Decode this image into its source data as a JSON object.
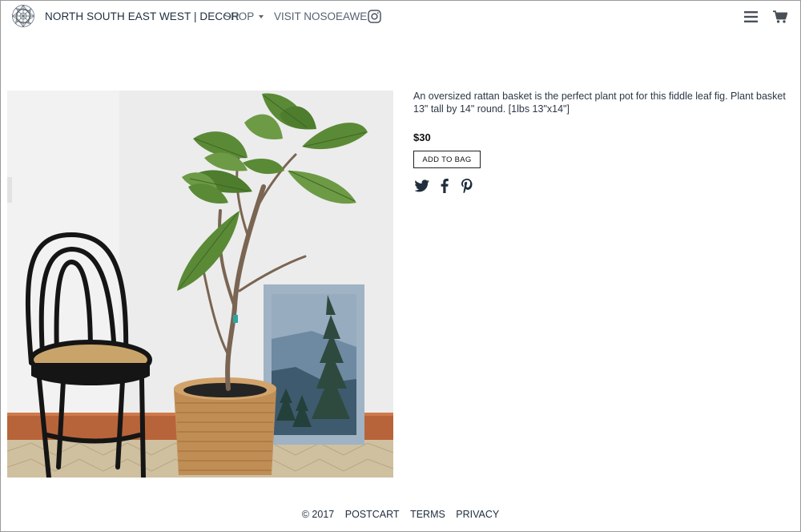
{
  "header": {
    "brand": "NORTH SOUTH EAST WEST | DECOR",
    "nav": {
      "shop_label": "SHOP",
      "visit_label": "VISIT NOSOEAWE"
    },
    "icons": [
      "logo-mandala-icon",
      "chevron-down-icon",
      "instagram-icon",
      "menu-icon",
      "cart-icon"
    ]
  },
  "product": {
    "description": "An oversized rattan basket is the perfect plant pot for this fiddle leaf fig. Plant basket 13\" tall by 14\" round. [1lbs 13\"x14\"]",
    "price": "$30",
    "add_to_bag_label": "ADD TO BAG",
    "share_icons": [
      "twitter-icon",
      "facebook-icon",
      "pinterest-icon"
    ]
  },
  "footer": {
    "copyright": "© 2017",
    "links": [
      "POSTCART",
      "TERMS",
      "PRIVACY"
    ]
  },
  "colors": {
    "text_dark": "#1f2d3d",
    "text_muted": "#556270",
    "border": "#222222"
  }
}
